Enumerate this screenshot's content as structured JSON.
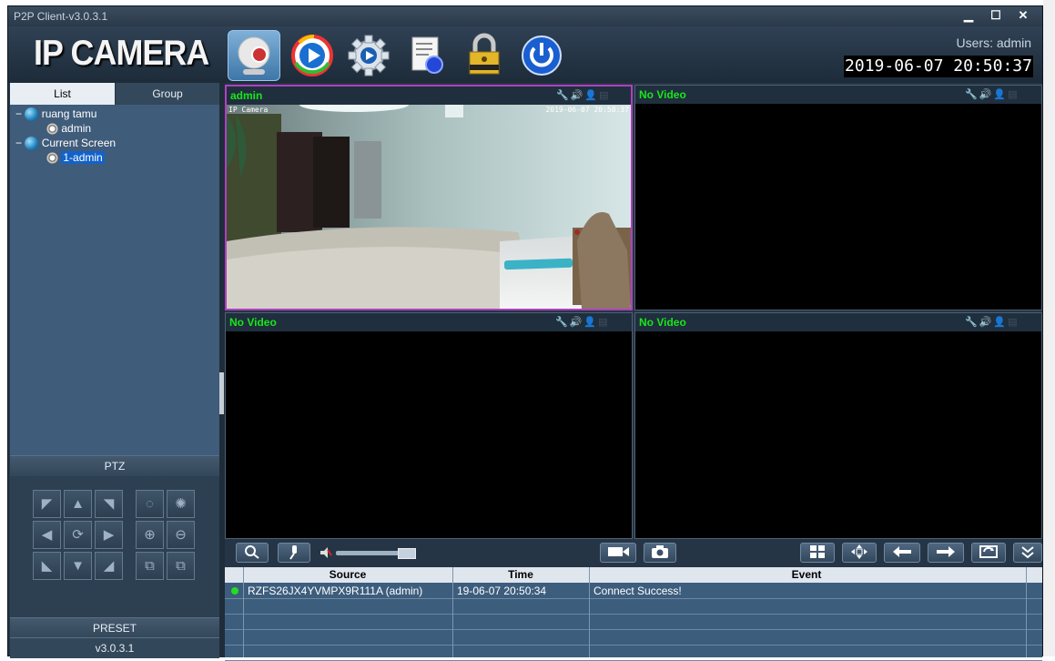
{
  "window": {
    "title": "P2P Client-v3.0.3.1",
    "minimize": "▁",
    "maximize": "☐",
    "close": "✕"
  },
  "header": {
    "logo": "IP CAMERA",
    "users_label": "Users: admin",
    "datetime": "2019-06-07 20:50:37",
    "toolbar": [
      {
        "name": "live-view",
        "icon": "webcam-icon"
      },
      {
        "name": "playback",
        "icon": "playback-icon"
      },
      {
        "name": "settings",
        "icon": "gear-icon"
      },
      {
        "name": "log",
        "icon": "document-icon"
      },
      {
        "name": "lock",
        "icon": "lock-icon"
      },
      {
        "name": "exit",
        "icon": "power-icon"
      }
    ]
  },
  "sidebar": {
    "tabs": [
      "List",
      "Group"
    ],
    "tree": [
      {
        "toggle": "−",
        "label": "ruang tamu",
        "children": [
          "admin"
        ]
      },
      {
        "toggle": "−",
        "label": "Current Screen",
        "children": [
          "1-admin"
        ]
      }
    ],
    "ptz_label": "PTZ",
    "preset_label": "PRESET",
    "version": "v3.0.3.1"
  },
  "video": {
    "cells": [
      {
        "name": "admin",
        "overlay_left": "IP Camera",
        "overlay_right": "2019-06-07 20:50:37"
      },
      {
        "name": "No Video"
      },
      {
        "name": "No Video"
      },
      {
        "name": "No Video"
      }
    ]
  },
  "log": {
    "columns": [
      "Source",
      "Time",
      "Event"
    ],
    "rows": [
      {
        "source": "RZFS26JX4YVMPX9R111A (admin)",
        "time": "19-06-07 20:50:34",
        "event": "Connect Success!",
        "status_color": "#22dd22"
      }
    ]
  },
  "colors": {
    "accent_green": "#19e619",
    "selected_border": "#b040c0",
    "tree_select": "#1262c9"
  }
}
